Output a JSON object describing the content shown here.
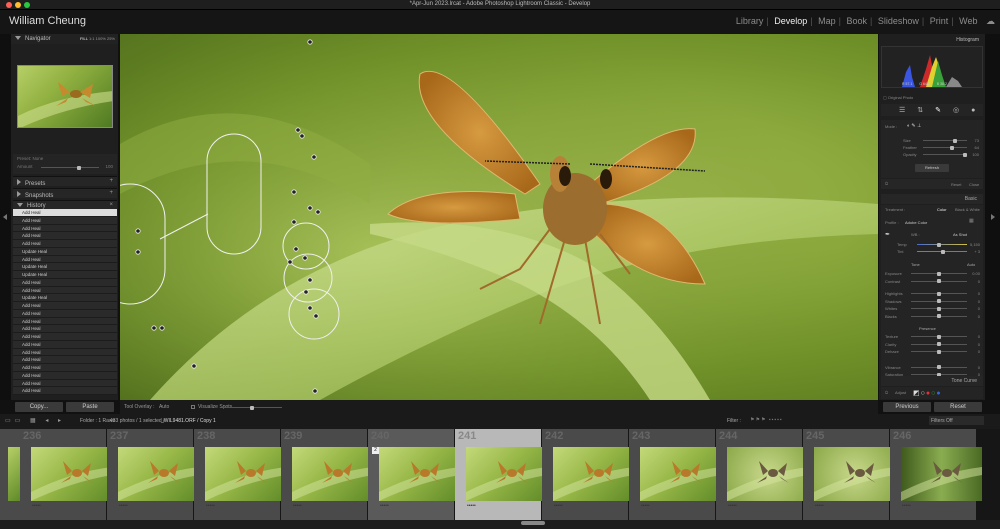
{
  "window": {
    "title": "*Apr-Jun 2023.lrcat - Adobe Photoshop Lightroom Classic - Develop"
  },
  "identity": {
    "name": "William Cheung"
  },
  "modules": [
    {
      "label": "Library",
      "active": false
    },
    {
      "label": "Develop",
      "active": true
    },
    {
      "label": "Map",
      "active": false
    },
    {
      "label": "Book",
      "active": false
    },
    {
      "label": "Slideshow",
      "active": false
    },
    {
      "label": "Print",
      "active": false
    },
    {
      "label": "Web",
      "active": false
    }
  ],
  "left_panel": {
    "navigator": {
      "title": "Navigator",
      "zoom_options": [
        "FILL",
        "1:1",
        "100%",
        "25%"
      ]
    },
    "preset_amount": {
      "label": "Preset: None",
      "amount_label": "Amount",
      "amount_value": "100"
    },
    "presets": {
      "title": "Presets"
    },
    "snapshots": {
      "title": "Snapshots"
    },
    "history": {
      "title": "History",
      "items": [
        "Add Heal",
        "Add Heal",
        "Add Heal",
        "Add Heal",
        "Add Heal",
        "Update Heal",
        "Add Heal",
        "Update Heal",
        "Update Heal",
        "Add Heal",
        "Add Heal",
        "Update Heal",
        "Add Heal",
        "Add Heal",
        "Add Heal",
        "Add Heal",
        "Add Heal",
        "Add Heal",
        "Add Heal",
        "Add Heal",
        "Add Heal",
        "Add Heal",
        "Add Heal",
        "Add Heal"
      ]
    },
    "copy_label": "Copy...",
    "paste_label": "Paste"
  },
  "toolbar": {
    "tool_overlay_label": "Tool Overlay :",
    "tool_overlay_value": "Auto",
    "visualize_spots_label": "Visualize Spots"
  },
  "right_panel": {
    "histogram": {
      "title": "Histogram",
      "iso": "ISO 400",
      "focal": "400 mm",
      "aperture": "f/5.6",
      "shutter": "1/400 sec",
      "readout_r": "R 57.1",
      "readout_g": "G 64.2",
      "readout_b": "B 38.2",
      "original_photo_label": "Original Photo"
    },
    "heal": {
      "mode_label": "Mode :",
      "size_label": "Size",
      "size_value": "73",
      "feather_label": "Feather",
      "feather_value": "64",
      "opacity_label": "Opacity",
      "opacity_value": "100",
      "refresh_label": "Refresh",
      "reset_label": "Reset",
      "close_label": "Close"
    },
    "basic": {
      "title": "Basic",
      "treatment_label": "Treatment :",
      "color_label": "Color",
      "bw_label": "Black & White",
      "profile_label": "Profile :",
      "profile_value": "Adobe Color",
      "wb_label": "WB :",
      "wb_value": "As Shot",
      "temp_label": "Temp",
      "temp_value": "5,150",
      "tint_label": "Tint",
      "tint_value": "+ 3",
      "tone_label": "Tone",
      "auto_label": "Auto",
      "sliders": [
        {
          "label": "Exposure",
          "value": "0.00"
        },
        {
          "label": "Contrast",
          "value": "0"
        },
        {
          "label": "Highlights",
          "value": "0"
        },
        {
          "label": "Shadows",
          "value": "0"
        },
        {
          "label": "Whites",
          "value": "0"
        },
        {
          "label": "Blacks",
          "value": "0"
        }
      ],
      "presence_label": "Presence",
      "presence_sliders": [
        {
          "label": "Texture",
          "value": "0"
        },
        {
          "label": "Clarity",
          "value": "0"
        },
        {
          "label": "Dehaze",
          "value": "0"
        },
        {
          "label": "Vibrance",
          "value": "0"
        },
        {
          "label": "Saturation",
          "value": "0"
        }
      ]
    },
    "tone_curve": {
      "title": "Tone Curve",
      "adjust_label": "Adjust"
    },
    "previous_label": "Previous",
    "reset_label": "Reset"
  },
  "filmstrip_bar": {
    "folder_label": "Folder : 1 Raws",
    "count_label": "433 photos / 1 selected /",
    "filename": "_WIL9481.ORF / Copy 1",
    "filter_label": "Filter :",
    "filters_value": "Filters Off"
  },
  "filmstrip": [
    {
      "num": "236",
      "stars": "•••••"
    },
    {
      "num": "237",
      "stars": "•••••"
    },
    {
      "num": "238",
      "stars": "•••••"
    },
    {
      "num": "239",
      "stars": "•••••"
    },
    {
      "num": "240",
      "stars": "•••••"
    },
    {
      "num": "241",
      "stars": "•••••"
    },
    {
      "num": "242",
      "stars": "•••••"
    },
    {
      "num": "243",
      "stars": "•••••"
    },
    {
      "num": "244",
      "stars": "•••••"
    },
    {
      "num": "245",
      "stars": "•••••"
    },
    {
      "num": "246",
      "stars": "•••••"
    }
  ],
  "stack_badge": "2",
  "colors": {
    "accent": "#e6e6e6",
    "background": "#1f1f1f",
    "selected_cell": "#b8b8b8"
  }
}
